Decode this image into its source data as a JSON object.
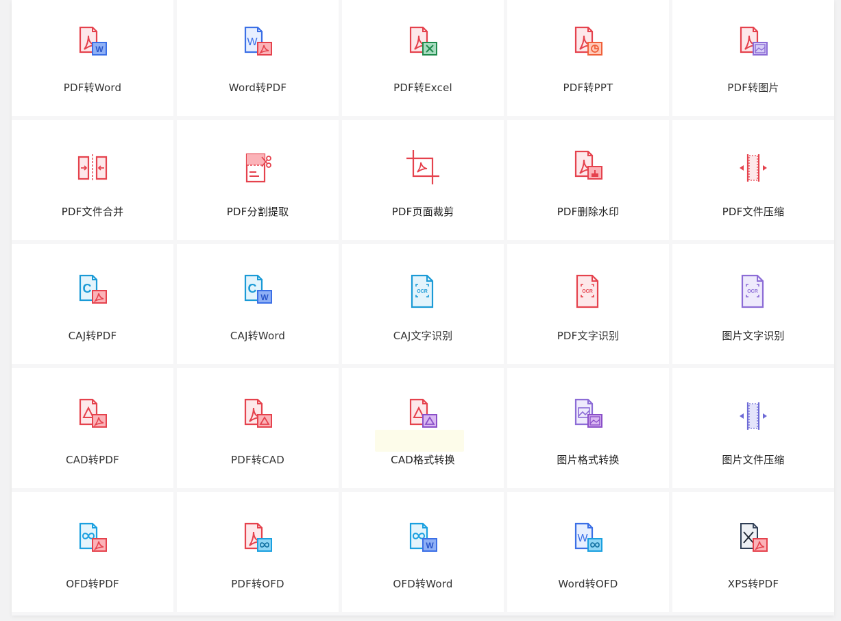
{
  "tools": [
    {
      "label": "PDF转Word",
      "icon": "pdf-to-word-icon"
    },
    {
      "label": "Word转PDF",
      "icon": "word-to-pdf-icon"
    },
    {
      "label": "PDF转Excel",
      "icon": "pdf-to-excel-icon"
    },
    {
      "label": "PDF转PPT",
      "icon": "pdf-to-ppt-icon"
    },
    {
      "label": "PDF转图片",
      "icon": "pdf-to-image-icon"
    },
    {
      "label": "PDF文件合并",
      "icon": "pdf-merge-icon"
    },
    {
      "label": "PDF分割提取",
      "icon": "pdf-split-icon"
    },
    {
      "label": "PDF页面裁剪",
      "icon": "pdf-crop-icon"
    },
    {
      "label": "PDF删除水印",
      "icon": "pdf-remove-watermark-icon"
    },
    {
      "label": "PDF文件压缩",
      "icon": "pdf-compress-icon"
    },
    {
      "label": "CAJ转PDF",
      "icon": "caj-to-pdf-icon"
    },
    {
      "label": "CAJ转Word",
      "icon": "caj-to-word-icon"
    },
    {
      "label": "CAJ文字识别",
      "icon": "caj-ocr-icon"
    },
    {
      "label": "PDF文字识别",
      "icon": "pdf-ocr-icon"
    },
    {
      "label": "图片文字识别",
      "icon": "image-ocr-icon"
    },
    {
      "label": "CAD转PDF",
      "icon": "cad-to-pdf-icon"
    },
    {
      "label": "PDF转CAD",
      "icon": "pdf-to-cad-icon"
    },
    {
      "label": "CAD格式转换",
      "icon": "cad-format-convert-icon"
    },
    {
      "label": "图片格式转换",
      "icon": "image-format-convert-icon"
    },
    {
      "label": "图片文件压缩",
      "icon": "image-compress-icon"
    },
    {
      "label": "OFD转PDF",
      "icon": "ofd-to-pdf-icon"
    },
    {
      "label": "PDF转OFD",
      "icon": "pdf-to-ofd-icon"
    },
    {
      "label": "OFD转Word",
      "icon": "ofd-to-word-icon"
    },
    {
      "label": "Word转OFD",
      "icon": "word-to-ofd-icon"
    },
    {
      "label": "XPS转PDF",
      "icon": "xps-to-pdf-icon"
    }
  ],
  "colors": {
    "pdf_red": "#e5424d",
    "word_blue": "#3b6fe6",
    "excel_green": "#1f8a4c",
    "ppt_orange": "#f0603a",
    "caj_blue": "#1a9ad6",
    "cad_purple": "#8a4fc8",
    "image_purple": "#8c6cd6",
    "ofd_blue": "#1aa0e0",
    "xps_dark": "#2f3e55"
  }
}
